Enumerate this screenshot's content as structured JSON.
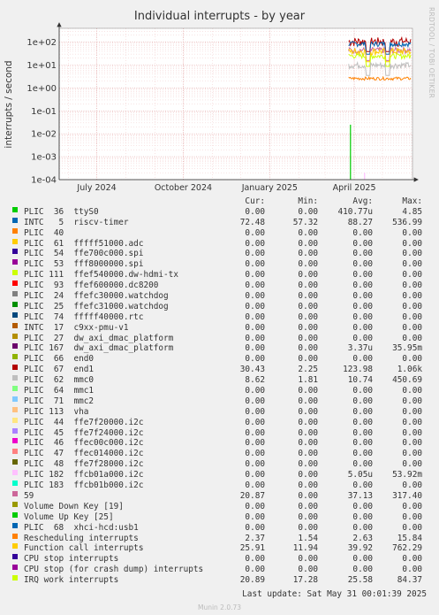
{
  "chart_data": {
    "type": "line",
    "title": "Individual interrupts - by year",
    "ylabel": "interrupts / second",
    "yscale": "log",
    "ylim": [
      0.0001,
      400
    ],
    "yticks": [
      {
        "v": 100,
        "label": "1e+02"
      },
      {
        "v": 10,
        "label": "1e+01"
      },
      {
        "v": 1,
        "label": "1e+00"
      },
      {
        "v": 0.1,
        "label": "1e-01"
      },
      {
        "v": 0.01,
        "label": "1e-02"
      },
      {
        "v": 0.001,
        "label": "1e-03"
      },
      {
        "v": 0.0001,
        "label": "1e-04"
      }
    ],
    "xlim": [
      "2024-05-22",
      "2025-06-02"
    ],
    "xticks": [
      {
        "date": "2024-07-01",
        "label": "July 2024"
      },
      {
        "date": "2024-10-01",
        "label": "October 2024"
      },
      {
        "date": "2025-01-01",
        "label": "January 2025"
      },
      {
        "date": "2025-04-01",
        "label": "April 2025"
      }
    ],
    "grid": true,
    "columns": {
      "cur": "Cur:",
      "min": "Min:",
      "avg": "Avg:",
      "max": "Max:"
    },
    "series": [
      {
        "name": "PLIC  36  ttyS0",
        "color": "#00cc00",
        "cur": "0.00",
        "min": "0.00",
        "avg": "410.77u",
        "max": "4.85"
      },
      {
        "name": "INTC   5  riscv-timer",
        "color": "#0066b3",
        "cur": "72.48",
        "min": "57.32",
        "avg": "88.27",
        "max": "536.99"
      },
      {
        "name": "PLIC  40",
        "color": "#ff8000",
        "cur": "0.00",
        "min": "0.00",
        "avg": "0.00",
        "max": "0.00"
      },
      {
        "name": "PLIC  61  fffff51000.adc",
        "color": "#ffcc00",
        "cur": "0.00",
        "min": "0.00",
        "avg": "0.00",
        "max": "0.00"
      },
      {
        "name": "PLIC  54  ffe700c000.spi",
        "color": "#330099",
        "cur": "0.00",
        "min": "0.00",
        "avg": "0.00",
        "max": "0.00"
      },
      {
        "name": "PLIC  53  fff8000000.spi",
        "color": "#990099",
        "cur": "0.00",
        "min": "0.00",
        "avg": "0.00",
        "max": "0.00"
      },
      {
        "name": "PLIC 111  ffef540000.dw-hdmi-tx",
        "color": "#ccff00",
        "cur": "0.00",
        "min": "0.00",
        "avg": "0.00",
        "max": "0.00"
      },
      {
        "name": "PLIC  93  ffef600000.dc8200",
        "color": "#ff0000",
        "cur": "0.00",
        "min": "0.00",
        "avg": "0.00",
        "max": "0.00"
      },
      {
        "name": "PLIC  24  ffefc30000.watchdog",
        "color": "#808080",
        "cur": "0.00",
        "min": "0.00",
        "avg": "0.00",
        "max": "0.00"
      },
      {
        "name": "PLIC  25  ffefc31000.watchdog",
        "color": "#008f00",
        "cur": "0.00",
        "min": "0.00",
        "avg": "0.00",
        "max": "0.00"
      },
      {
        "name": "PLIC  74  fffff40000.rtc",
        "color": "#00487d",
        "cur": "0.00",
        "min": "0.00",
        "avg": "0.00",
        "max": "0.00"
      },
      {
        "name": "INTC  17  c9xx-pmu-v1",
        "color": "#b35a00",
        "cur": "0.00",
        "min": "0.00",
        "avg": "0.00",
        "max": "0.00"
      },
      {
        "name": "PLIC  27  dw_axi_dmac_platform",
        "color": "#b38f00",
        "cur": "0.00",
        "min": "0.00",
        "avg": "0.00",
        "max": "0.00"
      },
      {
        "name": "PLIC 167  dw_axi_dmac_platform",
        "color": "#6b006b",
        "cur": "0.00",
        "min": "0.00",
        "avg": "3.37u",
        "max": "35.95m"
      },
      {
        "name": "PLIC  66  end0",
        "color": "#8fb300",
        "cur": "0.00",
        "min": "0.00",
        "avg": "0.00",
        "max": "0.00"
      },
      {
        "name": "PLIC  67  end1",
        "color": "#b30000",
        "cur": "30.43",
        "min": "2.25",
        "avg": "123.98",
        "max": "1.06k"
      },
      {
        "name": "PLIC  62  mmc0",
        "color": "#bebebe",
        "cur": "8.62",
        "min": "1.81",
        "avg": "10.74",
        "max": "450.69"
      },
      {
        "name": "PLIC  64  mmc1",
        "color": "#80ff80",
        "cur": "0.00",
        "min": "0.00",
        "avg": "0.00",
        "max": "0.00"
      },
      {
        "name": "PLIC  71  mmc2",
        "color": "#80c9ff",
        "cur": "0.00",
        "min": "0.00",
        "avg": "0.00",
        "max": "0.00"
      },
      {
        "name": "PLIC 113  vha",
        "color": "#ffc080",
        "cur": "0.00",
        "min": "0.00",
        "avg": "0.00",
        "max": "0.00"
      },
      {
        "name": "PLIC  44  ffe7f20000.i2c",
        "color": "#ffe680",
        "cur": "0.00",
        "min": "0.00",
        "avg": "0.00",
        "max": "0.00"
      },
      {
        "name": "PLIC  45  ffe7f24000.i2c",
        "color": "#aa80ff",
        "cur": "0.00",
        "min": "0.00",
        "avg": "0.00",
        "max": "0.00"
      },
      {
        "name": "PLIC  46  ffec00c000.i2c",
        "color": "#ee00cc",
        "cur": "0.00",
        "min": "0.00",
        "avg": "0.00",
        "max": "0.00"
      },
      {
        "name": "PLIC  47  ffec014000.i2c",
        "color": "#ff8080",
        "cur": "0.00",
        "min": "0.00",
        "avg": "0.00",
        "max": "0.00"
      },
      {
        "name": "PLIC  48  ffe7f28000.i2c",
        "color": "#666600",
        "cur": "0.00",
        "min": "0.00",
        "avg": "0.00",
        "max": "0.00"
      },
      {
        "name": "PLIC 182  ffcb01a000.i2c",
        "color": "#ffbfff",
        "cur": "0.00",
        "min": "0.00",
        "avg": "5.05u",
        "max": "53.92m"
      },
      {
        "name": "PLIC 183  ffcb01b000.i2c",
        "color": "#00ffcc",
        "cur": "0.00",
        "min": "0.00",
        "avg": "0.00",
        "max": "0.00"
      },
      {
        "name": "59",
        "color": "#cc6699",
        "cur": "20.87",
        "min": "0.00",
        "avg": "37.13",
        "max": "317.40"
      },
      {
        "name": "Volume Down Key [19]",
        "color": "#999900",
        "cur": "0.00",
        "min": "0.00",
        "avg": "0.00",
        "max": "0.00"
      },
      {
        "name": "Volume Up Key [25]",
        "color": "#00cc00",
        "cur": "0.00",
        "min": "0.00",
        "avg": "0.00",
        "max": "0.00"
      },
      {
        "name": "PLIC  68  xhci-hcd:usb1",
        "color": "#0066b3",
        "cur": "0.00",
        "min": "0.00",
        "avg": "0.00",
        "max": "0.00"
      },
      {
        "name": "Rescheduling interrupts",
        "color": "#ff8000",
        "cur": "2.37",
        "min": "1.54",
        "avg": "2.63",
        "max": "15.84"
      },
      {
        "name": "Function call interrupts",
        "color": "#ffcc00",
        "cur": "25.91",
        "min": "11.94",
        "avg": "39.92",
        "max": "762.29"
      },
      {
        "name": "CPU stop interrupts",
        "color": "#330099",
        "cur": "0.00",
        "min": "0.00",
        "avg": "0.00",
        "max": "0.00"
      },
      {
        "name": "CPU stop (for crash dump) interrupts",
        "color": "#990099",
        "cur": "0.00",
        "min": "0.00",
        "avg": "0.00",
        "max": "0.00"
      },
      {
        "name": "IRQ work interrupts",
        "color": "#ccff00",
        "cur": "20.89",
        "min": "17.28",
        "avg": "25.58",
        "max": "84.37"
      }
    ]
  },
  "side_note": "RRDTOOL / TOBI OETIKER",
  "last_update": "Last update: Sat May 31 00:01:39 2025",
  "munin_version": "Munin 2.0.73"
}
